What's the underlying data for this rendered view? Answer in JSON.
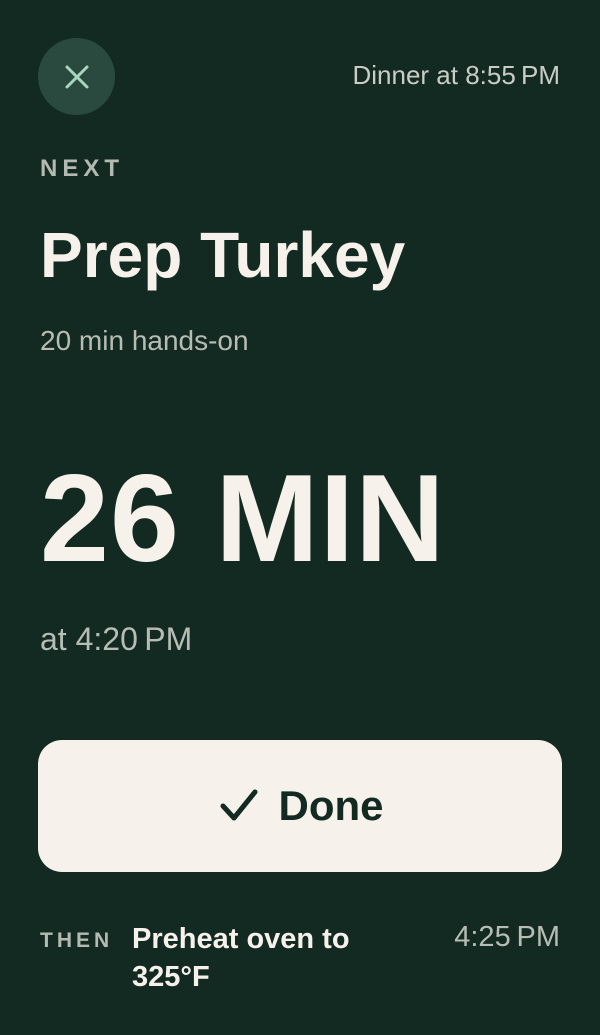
{
  "header": {
    "close_icon": "close-icon",
    "dinner_time": "Dinner at 8:55 PM"
  },
  "current": {
    "label": "NEXT",
    "title": "Prep Turkey",
    "hands_on": "20 min hands-on",
    "countdown": "26 MIN",
    "at_time": "at 4:20 PM"
  },
  "done_button": {
    "icon": "checkmark-icon",
    "label": "Done"
  },
  "upcoming": {
    "label": "THEN",
    "task": "Preheat oven to 325°F",
    "time": "4:25 PM"
  },
  "colors": {
    "background": "#132a22",
    "close_button_bg": "#2b4a3f",
    "close_icon": "#a9d6c1",
    "primary_text": "#f6f1ea",
    "secondary_text": "#b7bdb5",
    "button_bg": "#f6f1ea",
    "button_text": "#132a22"
  }
}
